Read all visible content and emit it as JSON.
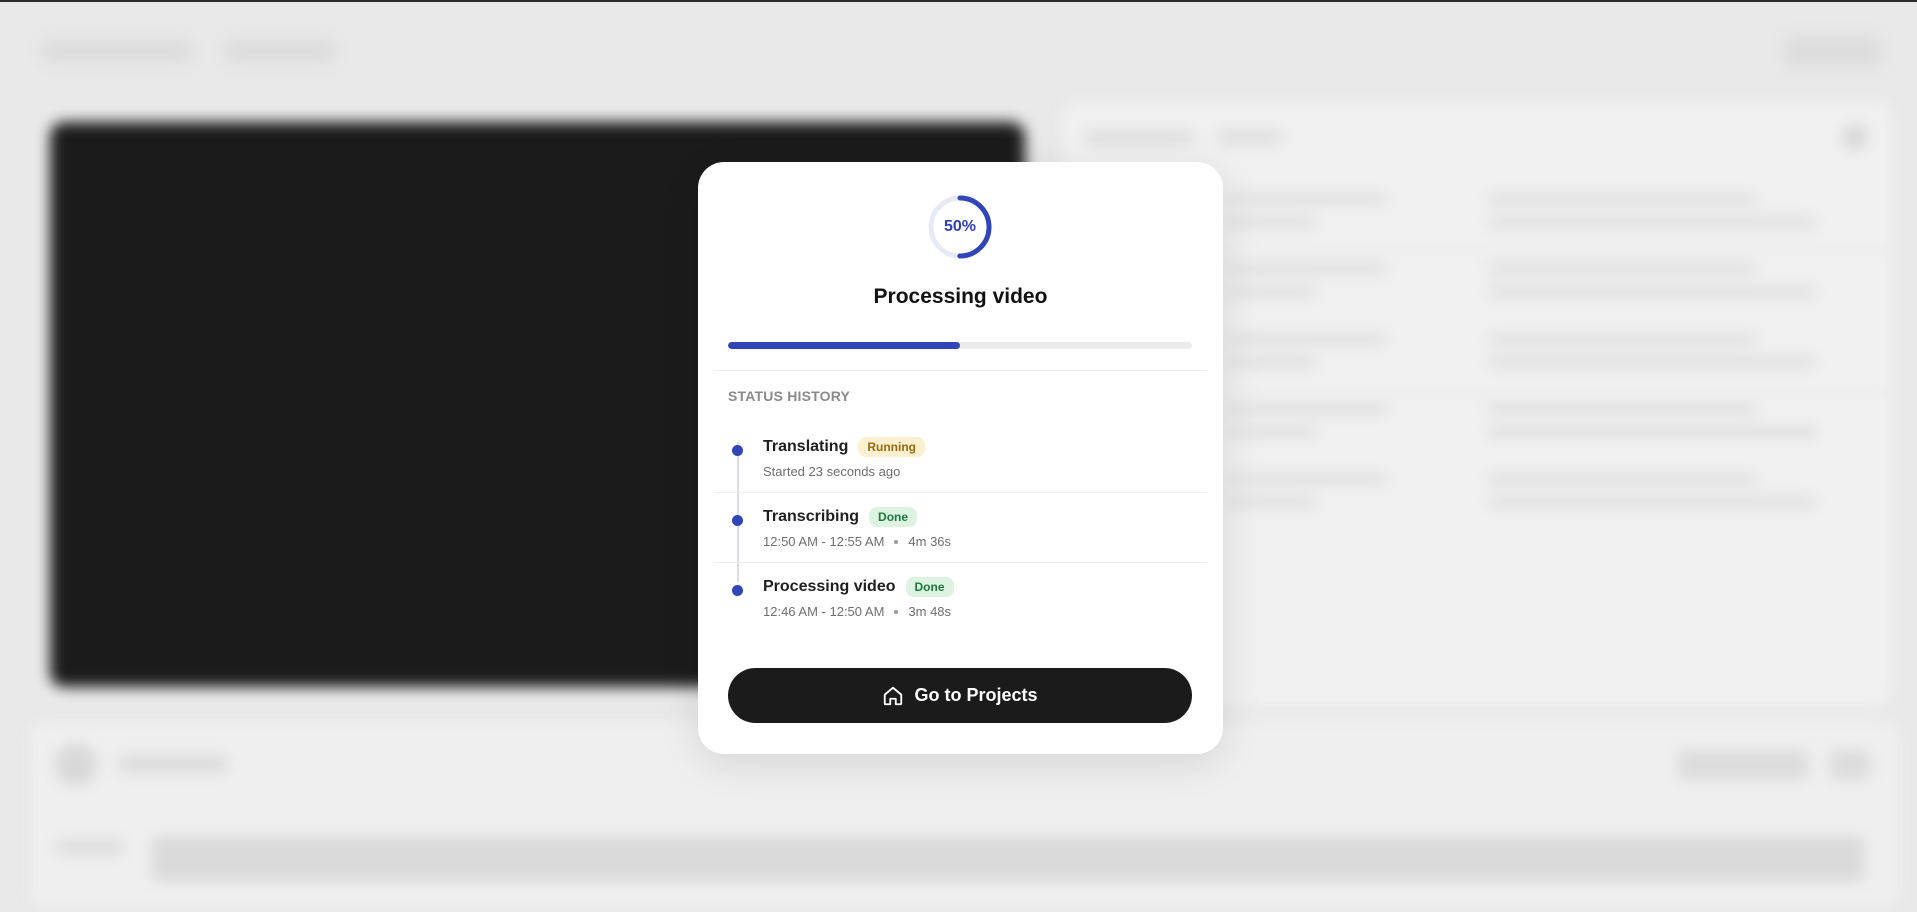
{
  "modal": {
    "progress_percent": 50,
    "progress_label": "50%",
    "title": "Processing video",
    "section_label": "STATUS HISTORY",
    "history": [
      {
        "name": "Translating",
        "status": "Running",
        "started": "Started 23 seconds ago"
      },
      {
        "name": "Transcribing",
        "status": "Done",
        "time_range": "12:50 AM - 12:55 AM",
        "duration": "4m 36s"
      },
      {
        "name": "Processing video",
        "status": "Done",
        "time_range": "12:46 AM - 12:50 AM",
        "duration": "3m 48s"
      }
    ],
    "cta_label": "Go to Projects",
    "cta_icon": "home-icon"
  },
  "colors": {
    "accent": "#2f45b8",
    "running_bg": "#fdf0cf",
    "running_fg": "#9a6a10",
    "done_bg": "#dcf3e2",
    "done_fg": "#1f7a3a",
    "cta_bg": "#1b1b1b"
  }
}
